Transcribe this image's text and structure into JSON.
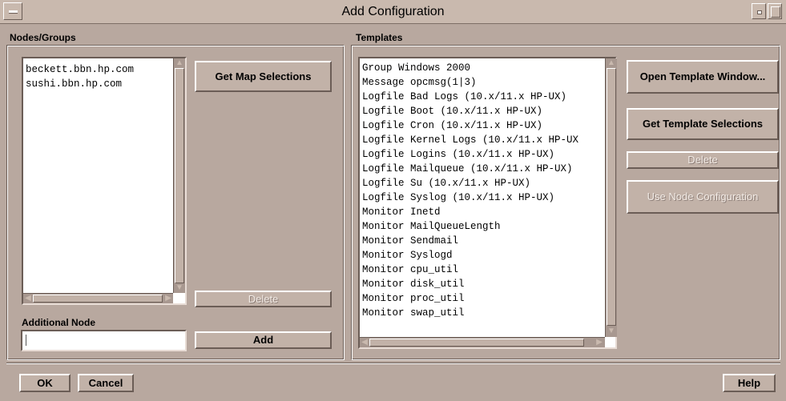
{
  "window": {
    "title": "Add Configuration"
  },
  "nodes": {
    "label": "Nodes/Groups",
    "items": [
      "beckett.bbn.hp.com",
      "sushi.bbn.hp.com"
    ],
    "get_map_label": "Get Map Selections",
    "delete_label": "Delete",
    "additional_node_label": "Additional Node",
    "additional_node_value": "",
    "add_label": "Add"
  },
  "templates": {
    "label": "Templates",
    "items": [
      "Group   Windows 2000",
      "Message opcmsg(1|3)",
      "Logfile Bad Logs (10.x/11.x HP-UX)",
      "Logfile Boot (10.x/11.x HP-UX)",
      "Logfile Cron (10.x/11.x HP-UX)",
      "Logfile Kernel Logs (10.x/11.x HP-UX",
      "Logfile Logins (10.x/11.x HP-UX)",
      "Logfile Mailqueue (10.x/11.x HP-UX)",
      "Logfile Su (10.x/11.x HP-UX)",
      "Logfile Syslog (10.x/11.x HP-UX)",
      "Monitor Inetd",
      "Monitor MailQueueLength",
      "Monitor Sendmail",
      "Monitor Syslogd",
      "Monitor cpu_util",
      "Monitor disk_util",
      "Monitor proc_util",
      "Monitor swap_util"
    ],
    "open_window_label": "Open Template Window...",
    "get_selections_label": "Get Template Selections",
    "delete_label": "Delete",
    "use_node_config_label": "Use Node Configuration"
  },
  "footer": {
    "ok_label": "OK",
    "cancel_label": "Cancel",
    "help_label": "Help"
  }
}
